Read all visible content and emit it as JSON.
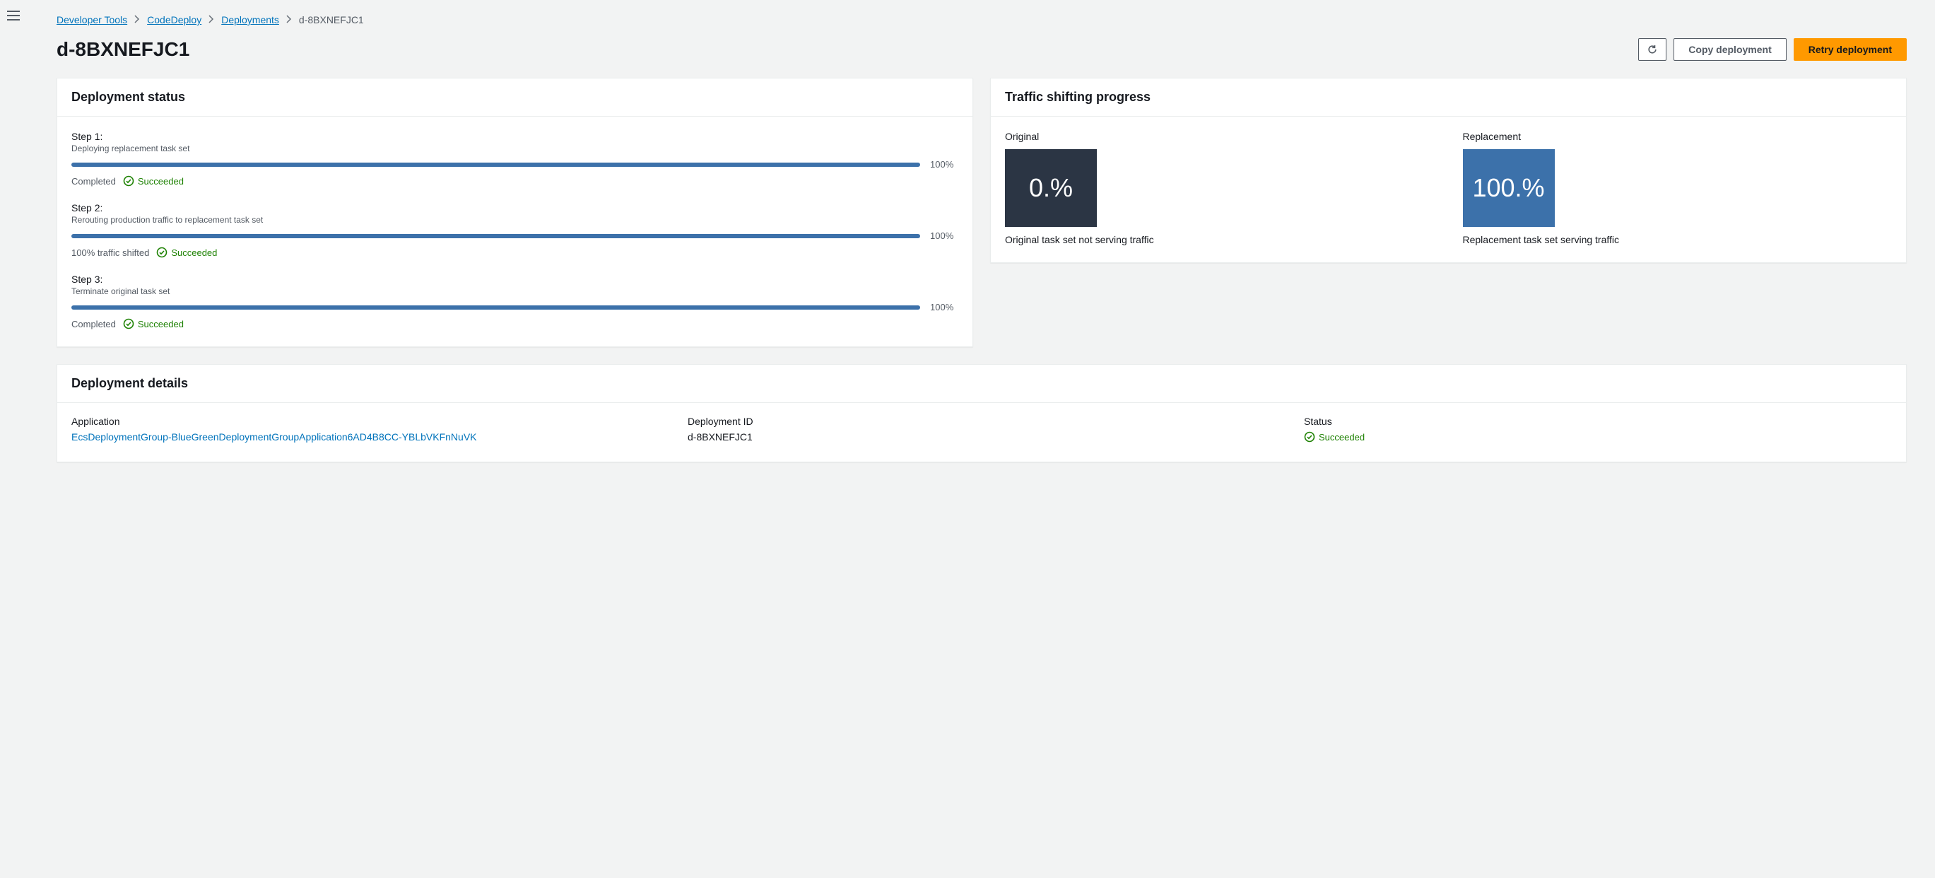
{
  "breadcrumbs": {
    "items": [
      "Developer Tools",
      "CodeDeploy",
      "Deployments"
    ],
    "current": "d-8BXNEFJC1"
  },
  "header": {
    "title": "d-8BXNEFJC1",
    "copy_label": "Copy deployment",
    "retry_label": "Retry deployment"
  },
  "deployment_status": {
    "title": "Deployment status",
    "steps": [
      {
        "title": "Step 1:",
        "desc": "Deploying replacement task set",
        "pct": "100%",
        "status_text": "Completed",
        "status_badge": "Succeeded"
      },
      {
        "title": "Step 2:",
        "desc": "Rerouting production traffic to replacement task set",
        "pct": "100%",
        "status_text": "100% traffic shifted",
        "status_badge": "Succeeded"
      },
      {
        "title": "Step 3:",
        "desc": "Terminate original task set",
        "pct": "100%",
        "status_text": "Completed",
        "status_badge": "Succeeded"
      }
    ]
  },
  "traffic": {
    "title": "Traffic shifting progress",
    "original": {
      "label": "Original",
      "value": "0.%",
      "caption": "Original task set not serving traffic"
    },
    "replacement": {
      "label": "Replacement",
      "value": "100.%",
      "caption": "Replacement task set serving traffic"
    }
  },
  "details": {
    "title": "Deployment details",
    "application": {
      "label": "Application",
      "value": "EcsDeploymentGroup-BlueGreenDeploymentGroupApplication6AD4B8CC-YBLbVKFnNuVK"
    },
    "deployment_id": {
      "label": "Deployment ID",
      "value": "d-8BXNEFJC1"
    },
    "status": {
      "label": "Status",
      "value": "Succeeded"
    }
  }
}
